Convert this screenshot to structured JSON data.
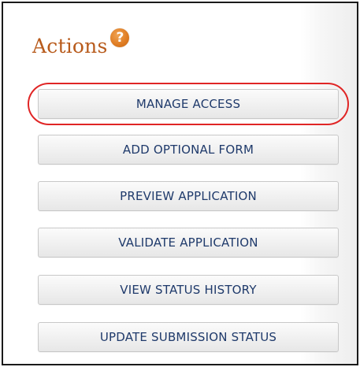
{
  "panel": {
    "title": "Actions",
    "help_icon": {
      "glyph": "?",
      "name": "help-icon",
      "color": "#e07e25"
    }
  },
  "actions": [
    {
      "label": "MANAGE ACCESS",
      "highlighted": true
    },
    {
      "label": "ADD OPTIONAL FORM"
    },
    {
      "label": "PREVIEW APPLICATION"
    },
    {
      "label": "VALIDATE APPLICATION"
    },
    {
      "label": "VIEW STATUS HISTORY"
    },
    {
      "label": "UPDATE SUBMISSION STATUS"
    }
  ],
  "colors": {
    "title": "#b85b1c",
    "button_text": "#1f3a6b",
    "highlight": "#e02525"
  }
}
